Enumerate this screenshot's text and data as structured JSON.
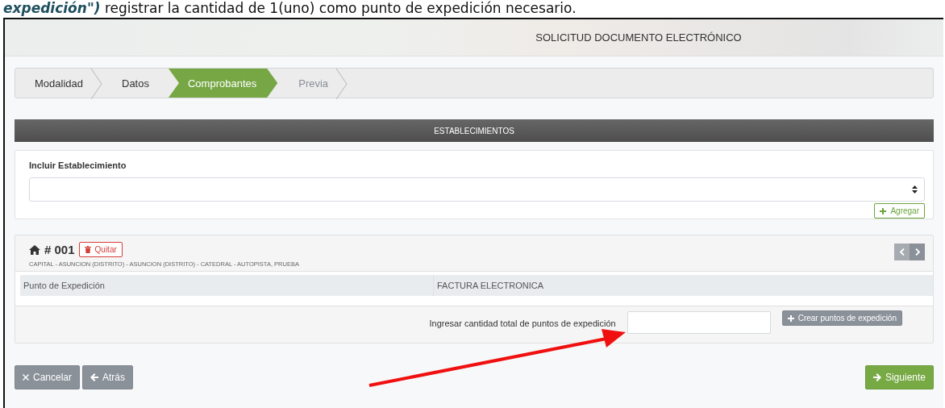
{
  "instruction": {
    "text": "**expedición\")** registrar la cantidad de 1(uno) como punto de expedición necesario."
  },
  "window": {
    "title": "SOLICITUD DOCUMENTO ELECTRÓNICO"
  },
  "steps": [
    {
      "label": "Modalidad",
      "selected": false,
      "disabled": false
    },
    {
      "label": "Datos",
      "selected": false,
      "disabled": false
    },
    {
      "label": "Comprobantes",
      "selected": true,
      "disabled": false
    },
    {
      "label": "Previa",
      "selected": false,
      "disabled": true
    }
  ],
  "section_bar": {
    "title": "ESTABLECIMIENTOS"
  },
  "include": {
    "label": "Incluir Establecimiento",
    "button": "Agregar"
  },
  "establishment": {
    "number": "# 001",
    "remove_button": "Quitar",
    "address": "CAPITAL - ASUNCION (DISTRITO) - ASUNCION (DISTRITO) - CATEDRAL - AUTOPISTA, PRUEBA",
    "table": {
      "columns": [
        "Punto de Expedición",
        "FACTURA ELECTRONICA"
      ]
    },
    "quantity_label": "Ingresar cantidad total de puntos de expedición",
    "create_button": "Crear puntos de expedición"
  },
  "footer": {
    "buttons": [
      {
        "label": "Cancelar",
        "kind": "cancel"
      },
      {
        "label": "Atrás",
        "kind": "back"
      },
      {
        "label": "Siguiente",
        "kind": "next"
      }
    ]
  },
  "annotation": {
    "kind": "arrow"
  }
}
